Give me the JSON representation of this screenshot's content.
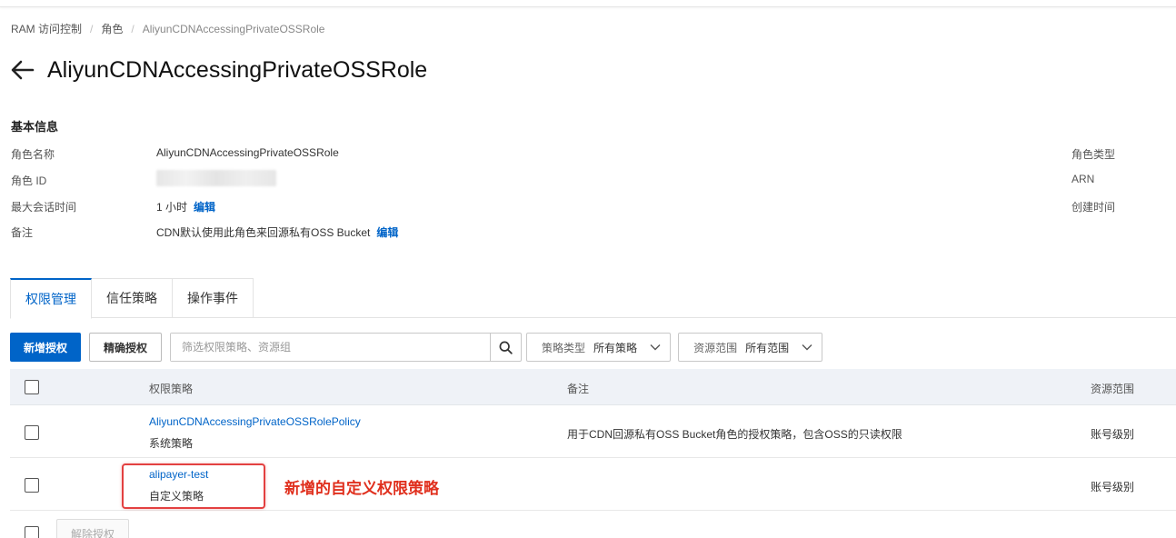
{
  "breadcrumb": {
    "items": [
      "RAM 访问控制",
      "角色",
      "AliyunCDNAccessingPrivateOSSRole"
    ]
  },
  "page": {
    "title": "AliyunCDNAccessingPrivateOSSRole"
  },
  "basic_info": {
    "section_title": "基本信息",
    "rows": [
      {
        "label": "角色名称",
        "value": "AliyunCDNAccessingPrivateOSSRole"
      },
      {
        "label": "角色 ID",
        "value": ""
      },
      {
        "label": "最大会话时间",
        "value": "1 小时",
        "edit": "编辑"
      },
      {
        "label": "备注",
        "value": "CDN默认使用此角色来回源私有OSS Bucket",
        "edit": "编辑"
      }
    ],
    "right_labels": [
      "角色类型",
      "ARN",
      "创建时间"
    ]
  },
  "tabs": [
    {
      "label": "权限管理",
      "active": true
    },
    {
      "label": "信任策略",
      "active": false
    },
    {
      "label": "操作事件",
      "active": false
    }
  ],
  "toolbar": {
    "add_label": "新增授权",
    "precise_label": "精确授权",
    "search_placeholder": "筛选权限策略、资源组",
    "policy_type_label": "策略类型",
    "policy_type_value": "所有策略",
    "scope_label": "资源范围",
    "scope_value": "所有范围"
  },
  "table": {
    "columns": [
      "权限策略",
      "备注",
      "资源范围"
    ],
    "rows": [
      {
        "name": "AliyunCDNAccessingPrivateOSSRolePolicy",
        "type": "系统策略",
        "note": "用于CDN回源私有OSS Bucket角色的授权策略，包含OSS的只读权限",
        "scope": "账号级别"
      },
      {
        "name": "alipayer-test",
        "type": "自定义策略",
        "note": "",
        "scope": "账号级别"
      }
    ]
  },
  "annotation": {
    "text": "新增的自定义权限策略",
    "color": "#e0301e"
  },
  "footer": {
    "revoke_label": "解除授权"
  },
  "colors": {
    "accent": "#0064c8",
    "header_bg": "#eff2f7"
  }
}
